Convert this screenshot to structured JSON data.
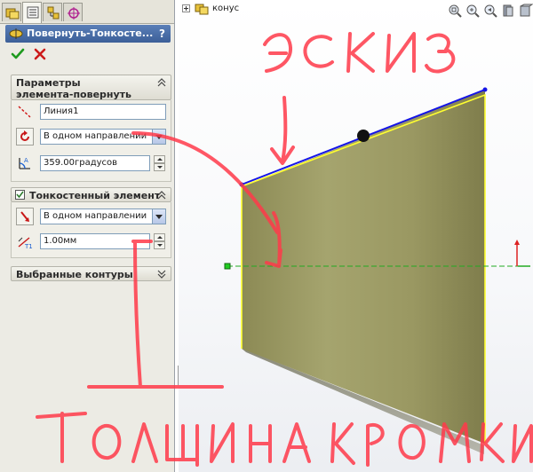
{
  "tabs": [
    {
      "name": "feature-manager-tab-icon",
      "active": false
    },
    {
      "name": "property-manager-tab-icon",
      "active": true
    },
    {
      "name": "configuration-manager-tab-icon",
      "active": false
    },
    {
      "name": "dimxpert-manager-tab-icon",
      "active": false
    }
  ],
  "pm": {
    "title": "Повернуть-Тонкосте...",
    "help": "?"
  },
  "params": {
    "title_line1": "Параметры",
    "title_line2": "элемента-повернуть",
    "axis_value": "Линия1",
    "direction_value": "В одном направлении",
    "angle_value": "359.00градусов"
  },
  "thin": {
    "title": "Тонкостенный элемент",
    "checked": true,
    "direction_value": "В одном направлении",
    "thickness_value": "1.00мм"
  },
  "contours": {
    "title": "Выбранные контуры"
  },
  "tree": {
    "label": "конус"
  },
  "annotations": {
    "top_text": "эскиз",
    "bottom_text": "толщина кромки",
    "color": "#ff3a4a"
  },
  "colors": {
    "title_bar": "#3c5f98",
    "face": "#9b9a62",
    "sketch_line": "#1414e6",
    "edge_highlight": "#ffff30",
    "axis_green": "#22aa22",
    "axis_red": "#dd2222"
  }
}
